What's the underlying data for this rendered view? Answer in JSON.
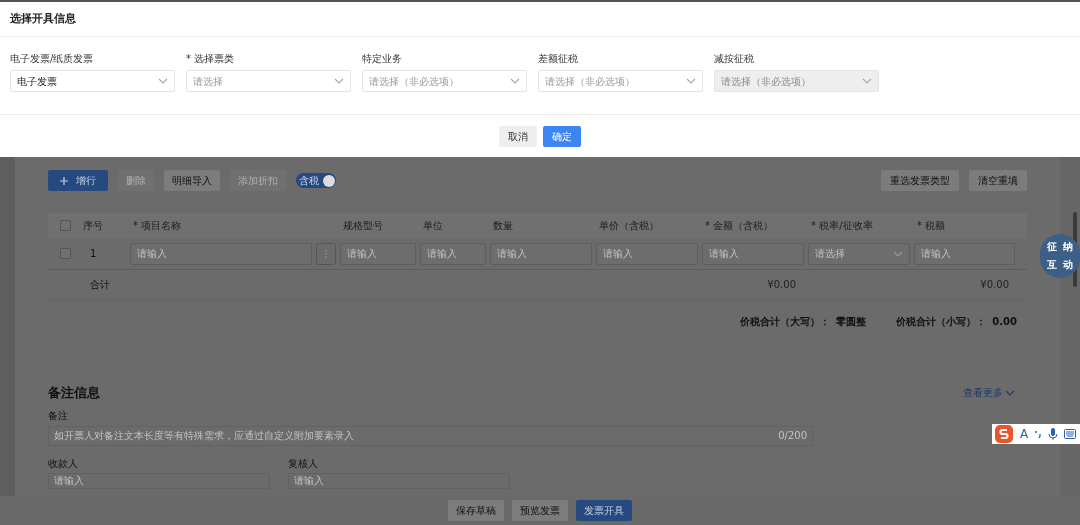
{
  "dialog": {
    "title": "选择开具信息",
    "fields": [
      {
        "label": "电子发票/纸质发票",
        "value": "电子发票",
        "disabled": false
      },
      {
        "label": "* 选择票类",
        "placeholder": "请选择",
        "disabled": false
      },
      {
        "label": "特定业务",
        "placeholder": "请选择（非必选项）",
        "disabled": false
      },
      {
        "label": "差额征税",
        "placeholder": "请选择（非必选项）",
        "disabled": false
      },
      {
        "label": "减按征税",
        "placeholder": "请选择（非必选项）",
        "disabled": true
      }
    ],
    "buttons": [
      {
        "label": "取消",
        "primary": false
      },
      {
        "label": "确定",
        "primary": true
      }
    ]
  },
  "toolbar": {
    "add_row": {
      "label": "增行"
    },
    "buttons": [
      {
        "label": "删除",
        "disabled": true
      },
      {
        "label": "明细导入",
        "disabled": false
      },
      {
        "label": "添加折扣",
        "disabled": true
      }
    ],
    "tax_toggle": {
      "label": "含税",
      "on": true
    },
    "right_buttons": [
      "重选发票类型",
      "清空重填"
    ]
  },
  "table": {
    "header_checkbox": {
      "checked": false
    },
    "columns": [
      "序号",
      "* 项目名称",
      "规格型号",
      "单位",
      "数量",
      "单价（含税）",
      "* 金额（含税）",
      "* 税率/征收率",
      "* 税额"
    ],
    "rows": [
      {
        "checked": false,
        "cells": [
          {
            "kind": "text",
            "text": "1"
          },
          {
            "kind": "input",
            "placeholder": "请输入"
          },
          {
            "kind": "input",
            "placeholder": "请输入"
          },
          {
            "kind": "input",
            "placeholder": "请输入"
          },
          {
            "kind": "input",
            "placeholder": "请输入"
          },
          {
            "kind": "input",
            "placeholder": "请输入"
          },
          {
            "kind": "input",
            "placeholder": "请输入"
          },
          {
            "kind": "select",
            "placeholder": "请选择"
          },
          {
            "kind": "input",
            "placeholder": "请输入"
          }
        ]
      }
    ],
    "total_row": {
      "label": "合计",
      "amount": "¥0.00",
      "tax": "¥0.00"
    }
  },
  "totals": [
    {
      "label": "价税合计（大写）：",
      "value": "零圆整"
    },
    {
      "label": "价税合计（小写）：",
      "value": "0.00"
    }
  ],
  "remarks": {
    "title": "备注信息",
    "more_link": "查看更多",
    "remark_label": "备注",
    "remark_placeholder": "如开票人对备注文本长度等有特殊需求，应通过自定义附加要素录入",
    "counter": "0/200",
    "people": [
      {
        "label": "收款人",
        "placeholder": "请输入"
      },
      {
        "label": "复核人",
        "placeholder": "请输入"
      }
    ]
  },
  "assistant": {
    "chars": [
      "征",
      "纳",
      "互",
      "动"
    ]
  },
  "ime_toolbar": {
    "mode": "A"
  },
  "footer_buttons": [
    {
      "label": "保存草稿",
      "primary": false
    },
    {
      "label": "预览发票",
      "primary": false
    },
    {
      "label": "发票开具",
      "primary": true
    }
  ]
}
